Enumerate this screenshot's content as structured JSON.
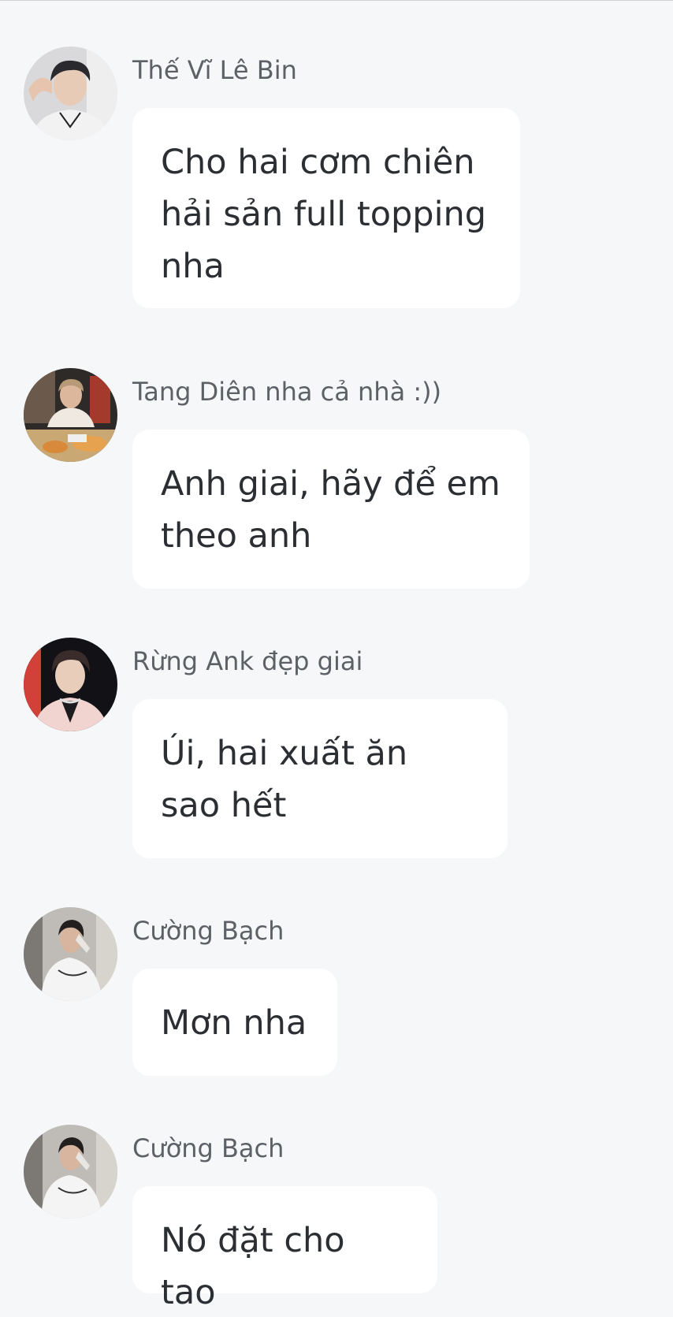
{
  "messages": [
    {
      "sender": "Thế Vĩ Lê Bin",
      "text": "Cho hai cơm chiên\nhải sản full topping\nnha",
      "avatar_icon": "user-avatar-photo"
    },
    {
      "sender": "Tang Diên nha cả nhà :))",
      "text": "Anh giai, hãy để em\ntheo anh",
      "avatar_icon": "user-avatar-photo"
    },
    {
      "sender": "Rừng Ank đẹp giai",
      "text": "Úi, hai xuất ăn\nsao hết",
      "avatar_icon": "user-avatar-photo"
    },
    {
      "sender": "Cường Bạch",
      "text": "Mơn nha",
      "avatar_icon": "user-avatar-photo"
    },
    {
      "sender": "Cường Bạch",
      "text": "Nó đặt cho tao",
      "avatar_icon": "user-avatar-photo"
    }
  ],
  "colors": {
    "background": "#f6f7f9",
    "bubble": "#ffffff",
    "sender_text": "#5d6166",
    "message_text": "#2b2e33"
  }
}
